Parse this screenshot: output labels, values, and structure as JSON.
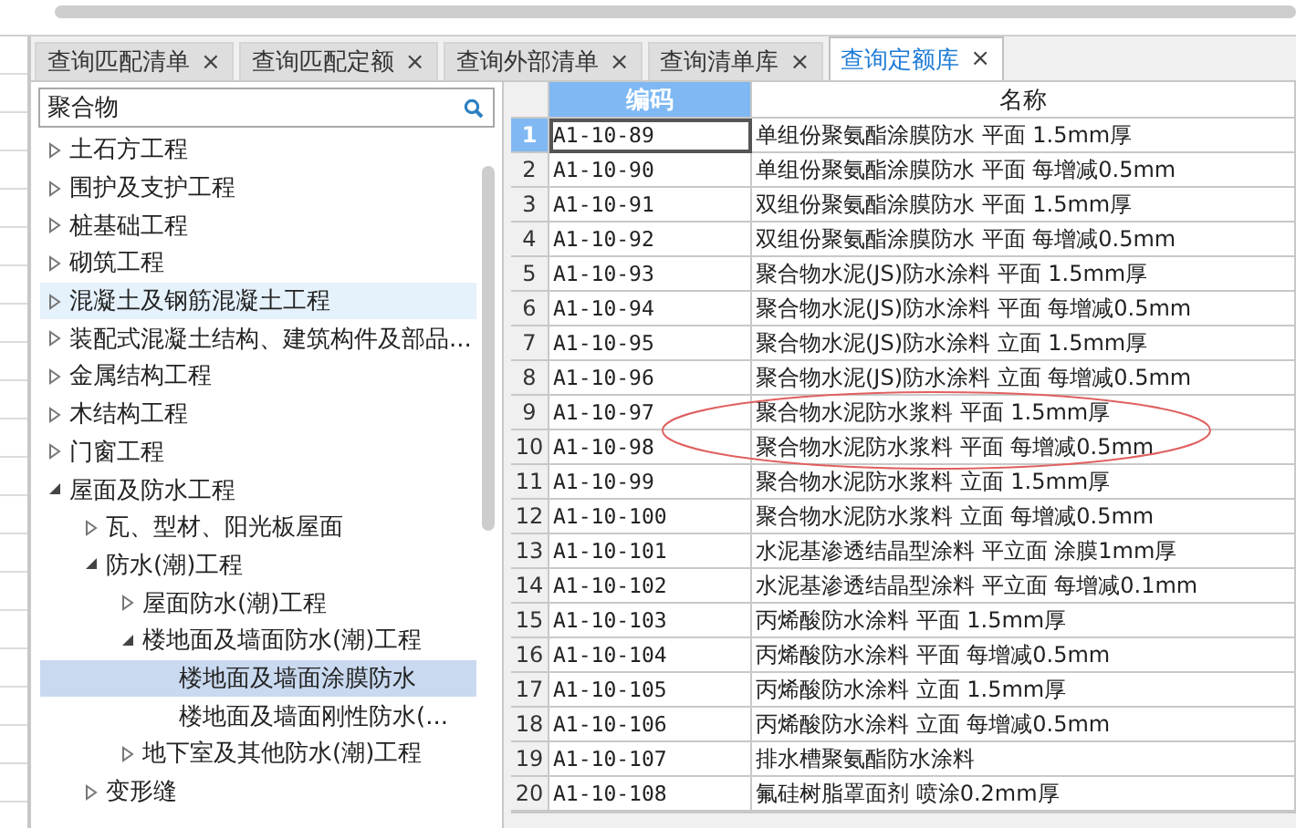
{
  "tabs": [
    {
      "label": "查询匹配清单",
      "close": "×",
      "selected": false
    },
    {
      "label": "查询匹配定额",
      "close": "×",
      "selected": false
    },
    {
      "label": "查询外部清单",
      "close": "×",
      "selected": false
    },
    {
      "label": "查询清单库",
      "close": "×",
      "selected": false
    },
    {
      "label": "查询定额库",
      "close": "×",
      "selected": true
    }
  ],
  "search": {
    "value": "聚合物"
  },
  "tree": [
    {
      "label": "土石方工程",
      "kind": "branch",
      "expanded": false,
      "selected": false,
      "hovered": false
    },
    {
      "label": "围护及支护工程",
      "kind": "branch",
      "expanded": false,
      "selected": false,
      "hovered": false
    },
    {
      "label": "桩基础工程",
      "kind": "branch",
      "expanded": false,
      "selected": false,
      "hovered": false
    },
    {
      "label": "砌筑工程",
      "kind": "branch",
      "expanded": false,
      "selected": false,
      "hovered": false
    },
    {
      "label": "混凝土及钢筋混凝土工程",
      "kind": "branch",
      "expanded": false,
      "selected": false,
      "hovered": true
    },
    {
      "label": "装配式混凝土结构、建筑构件及部品...",
      "kind": "branch",
      "expanded": false,
      "selected": false,
      "hovered": false
    },
    {
      "label": "金属结构工程",
      "kind": "branch",
      "expanded": false,
      "selected": false,
      "hovered": false
    },
    {
      "label": "木结构工程",
      "kind": "branch",
      "expanded": false,
      "selected": false,
      "hovered": false
    },
    {
      "label": "门窗工程",
      "kind": "branch",
      "expanded": false,
      "selected": false,
      "hovered": false
    },
    {
      "label": "屋面及防水工程",
      "kind": "branch",
      "expanded": true,
      "selected": false,
      "hovered": false,
      "children": [
        {
          "label": "瓦、型材、阳光板屋面",
          "kind": "branch",
          "expanded": false,
          "selected": false,
          "hovered": false
        },
        {
          "label": "防水(潮)工程",
          "kind": "branch",
          "expanded": true,
          "selected": false,
          "hovered": false,
          "children": [
            {
              "label": "屋面防水(潮)工程",
              "kind": "branch",
              "expanded": false,
              "selected": false,
              "hovered": false
            },
            {
              "label": "楼地面及墙面防水(潮)工程",
              "kind": "branch",
              "expanded": true,
              "selected": false,
              "hovered": false,
              "children": [
                {
                  "label": "楼地面及墙面涂膜防水",
                  "kind": "leaf",
                  "selected": true,
                  "hovered": false
                },
                {
                  "label": "楼地面及墙面刚性防水(...",
                  "kind": "leaf",
                  "selected": false,
                  "hovered": false
                }
              ]
            },
            {
              "label": "地下室及其他防水(潮)工程",
              "kind": "branch",
              "expanded": false,
              "selected": false,
              "hovered": false
            }
          ]
        },
        {
          "label": "变形缝",
          "kind": "branch",
          "expanded": false,
          "selected": false,
          "hovered": false
        }
      ]
    }
  ],
  "table": {
    "columns": [
      {
        "label": "编码",
        "selected": true
      },
      {
        "label": "名称",
        "selected": false
      }
    ],
    "rows": [
      {
        "number": "1",
        "code": "A1-10-89",
        "name": "单组份聚氨酯涂膜防水 平面 1.5mm厚",
        "selected": true
      },
      {
        "number": "2",
        "code": "A1-10-90",
        "name": "单组份聚氨酯涂膜防水 平面 每增减0.5mm",
        "selected": false
      },
      {
        "number": "3",
        "code": "A1-10-91",
        "name": "双组份聚氨酯涂膜防水 平面 1.5mm厚",
        "selected": false
      },
      {
        "number": "4",
        "code": "A1-10-92",
        "name": "双组份聚氨酯涂膜防水 平面 每增减0.5mm",
        "selected": false
      },
      {
        "number": "5",
        "code": "A1-10-93",
        "name": "聚合物水泥(JS)防水涂料 平面 1.5mm厚",
        "selected": false
      },
      {
        "number": "6",
        "code": "A1-10-94",
        "name": "聚合物水泥(JS)防水涂料 平面 每增减0.5mm",
        "selected": false
      },
      {
        "number": "7",
        "code": "A1-10-95",
        "name": "聚合物水泥(JS)防水涂料 立面 1.5mm厚",
        "selected": false
      },
      {
        "number": "8",
        "code": "A1-10-96",
        "name": "聚合物水泥(JS)防水涂料 立面 每增减0.5mm",
        "selected": false
      },
      {
        "number": "9",
        "code": "A1-10-97",
        "name": "聚合物水泥防水浆料 平面 1.5mm厚",
        "selected": false
      },
      {
        "number": "10",
        "code": "A1-10-98",
        "name": "聚合物水泥防水浆料 平面 每增减0.5mm",
        "selected": false
      },
      {
        "number": "11",
        "code": "A1-10-99",
        "name": "聚合物水泥防水浆料 立面 1.5mm厚",
        "selected": false
      },
      {
        "number": "12",
        "code": "A1-10-100",
        "name": "聚合物水泥防水浆料 立面 每增减0.5mm",
        "selected": false
      },
      {
        "number": "13",
        "code": "A1-10-101",
        "name": "水泥基渗透结晶型涂料 平立面 涂膜1mm厚",
        "selected": false
      },
      {
        "number": "14",
        "code": "A1-10-102",
        "name": "水泥基渗透结晶型涂料 平立面 每增减0.1mm",
        "selected": false
      },
      {
        "number": "15",
        "code": "A1-10-103",
        "name": "丙烯酸防水涂料 平面 1.5mm厚",
        "selected": false
      },
      {
        "number": "16",
        "code": "A1-10-104",
        "name": "丙烯酸防水涂料 平面 每增减0.5mm",
        "selected": false
      },
      {
        "number": "17",
        "code": "A1-10-105",
        "name": "丙烯酸防水涂料 立面 1.5mm厚",
        "selected": false
      },
      {
        "number": "18",
        "code": "A1-10-106",
        "name": "丙烯酸防水涂料 立面 每增减0.5mm",
        "selected": false
      },
      {
        "number": "19",
        "code": "A1-10-107",
        "name": "排水槽聚氨酯防水涂料",
        "selected": false
      },
      {
        "number": "20",
        "code": "A1-10-108",
        "name": "氟硅树脂罩面剂 喷涂0.2mm厚",
        "selected": false
      }
    ]
  }
}
